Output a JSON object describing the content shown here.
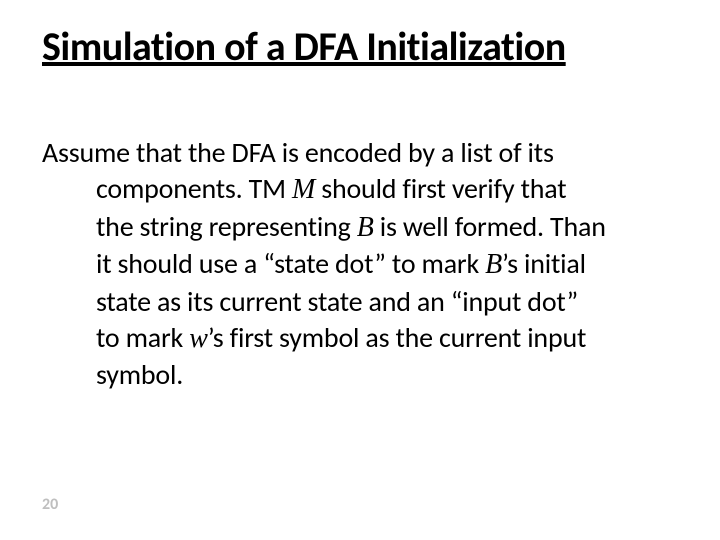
{
  "slide": {
    "title": "Simulation of a DFA Initialization",
    "body": {
      "l1": "Assume that the DFA is encoded by a list of its",
      "l2a": "components. TM ",
      "l2m": "M",
      "l2b": " should first verify that",
      "l3a": "the string representing ",
      "l3m": "B",
      "l3b": " is well formed. Than",
      "l4a": "it should use a “state dot”  to mark ",
      "l4m": "B",
      "l4b": "’s initial",
      "l5": "state as its current state and an “input dot”",
      "l6a": "to mark ",
      "l6m": "w",
      "l6b": "’s first symbol as the current input",
      "l7": "symbol."
    },
    "page_number": "20"
  }
}
